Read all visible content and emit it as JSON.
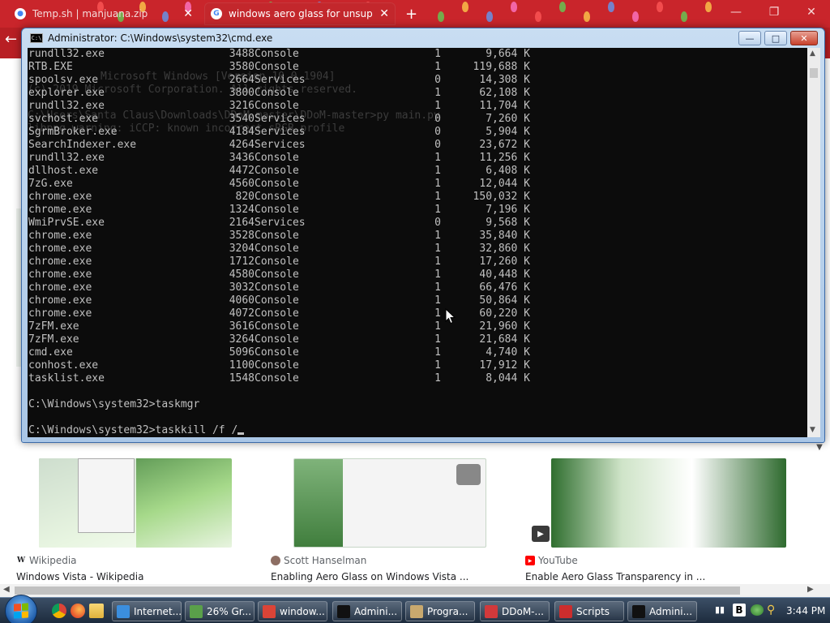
{
  "browser": {
    "tabs": [
      {
        "title": "Temp.sh | manjuana.zip",
        "active": false
      },
      {
        "title": "windows aero glass for unsuppo",
        "active": true
      }
    ],
    "new_tab": "+",
    "window_controls": {
      "minimize": "—",
      "restore": "❐",
      "close": "✕"
    },
    "back": "←",
    "results": [
      {
        "source": "Wikipedia",
        "title": "Windows Vista - Wikipedia",
        "icon": "wikipedia-icon"
      },
      {
        "source": "Scott Hanselman",
        "title": "Enabling Aero Glass on Windows Vista ...",
        "icon": "person-icon"
      },
      {
        "source": "YouTube",
        "title": "Enable Aero Glass Transparency in ...",
        "icon": "youtube-icon"
      }
    ],
    "accent": "#c9252b"
  },
  "cmd": {
    "title": "Administrator: C:\\Windows\\system32\\cmd.exe",
    "icon_label": "C:\\",
    "controls": {
      "minimize": "—",
      "maximize": "□",
      "close": "✕"
    },
    "background_ghost_lines": [
      "Microsoft Windows [Version 10.0.1904]",
      "(c) 2019 Microsoft Corporation. All rights reserved.",
      "C:\\Users\\Santa Claus\\Downloads\\DDoM-master\\DDoM-master>py main.py",
      "libpng warning: iCCP: known incorrect sRGB profile"
    ],
    "processes": [
      {
        "name": "rundll32.exe",
        "pid": "3488",
        "session": "Console",
        "num": "1",
        "mem": "9,664 K"
      },
      {
        "name": "RTB.EXE",
        "pid": "3580",
        "session": "Console",
        "num": "1",
        "mem": "119,688 K"
      },
      {
        "name": "spoolsv.exe",
        "pid": "2664",
        "session": "Services",
        "num": "0",
        "mem": "14,308 K"
      },
      {
        "name": "explorer.exe",
        "pid": "3800",
        "session": "Console",
        "num": "1",
        "mem": "62,108 K"
      },
      {
        "name": "rundll32.exe",
        "pid": "3216",
        "session": "Console",
        "num": "1",
        "mem": "11,704 K"
      },
      {
        "name": "svchost.exe",
        "pid": "3540",
        "session": "Services",
        "num": "0",
        "mem": "7,260 K"
      },
      {
        "name": "SgrmBroker.exe",
        "pid": "4184",
        "session": "Services",
        "num": "0",
        "mem": "5,904 K"
      },
      {
        "name": "SearchIndexer.exe",
        "pid": "4264",
        "session": "Services",
        "num": "0",
        "mem": "23,672 K"
      },
      {
        "name": "rundll32.exe",
        "pid": "3436",
        "session": "Console",
        "num": "1",
        "mem": "11,256 K"
      },
      {
        "name": "dllhost.exe",
        "pid": "4472",
        "session": "Console",
        "num": "1",
        "mem": "6,408 K"
      },
      {
        "name": "7zG.exe",
        "pid": "4560",
        "session": "Console",
        "num": "1",
        "mem": "12,044 K"
      },
      {
        "name": "chrome.exe",
        "pid": "820",
        "session": "Console",
        "num": "1",
        "mem": "150,032 K"
      },
      {
        "name": "chrome.exe",
        "pid": "1324",
        "session": "Console",
        "num": "1",
        "mem": "7,196 K"
      },
      {
        "name": "WmiPrvSE.exe",
        "pid": "2164",
        "session": "Services",
        "num": "0",
        "mem": "9,568 K"
      },
      {
        "name": "chrome.exe",
        "pid": "3528",
        "session": "Console",
        "num": "1",
        "mem": "35,840 K"
      },
      {
        "name": "chrome.exe",
        "pid": "3204",
        "session": "Console",
        "num": "1",
        "mem": "32,860 K"
      },
      {
        "name": "chrome.exe",
        "pid": "1712",
        "session": "Console",
        "num": "1",
        "mem": "17,260 K"
      },
      {
        "name": "chrome.exe",
        "pid": "4580",
        "session": "Console",
        "num": "1",
        "mem": "40,448 K"
      },
      {
        "name": "chrome.exe",
        "pid": "3032",
        "session": "Console",
        "num": "1",
        "mem": "66,476 K"
      },
      {
        "name": "chrome.exe",
        "pid": "4060",
        "session": "Console",
        "num": "1",
        "mem": "50,864 K"
      },
      {
        "name": "chrome.exe",
        "pid": "4072",
        "session": "Console",
        "num": "1",
        "mem": "60,220 K"
      },
      {
        "name": "7zFM.exe",
        "pid": "3616",
        "session": "Console",
        "num": "1",
        "mem": "21,960 K"
      },
      {
        "name": "7zFM.exe",
        "pid": "3264",
        "session": "Console",
        "num": "1",
        "mem": "21,684 K"
      },
      {
        "name": "cmd.exe",
        "pid": "5096",
        "session": "Console",
        "num": "1",
        "mem": "4,740 K"
      },
      {
        "name": "conhost.exe",
        "pid": "1100",
        "session": "Console",
        "num": "1",
        "mem": "17,912 K"
      },
      {
        "name": "tasklist.exe",
        "pid": "1548",
        "session": "Console",
        "num": "1",
        "mem": "8,044 K"
      }
    ],
    "prompt_lines": [
      "C:\\Windows\\system32>taskmgr",
      "C:\\Windows\\system32>taskkill /f /"
    ]
  },
  "taskbar": {
    "tasks": [
      {
        "label": "Internet...",
        "icon": "ie-icon"
      },
      {
        "label": "26% Gr...",
        "icon": "globe-icon"
      },
      {
        "label": "window...",
        "icon": "chrome-icon"
      },
      {
        "label": "Admini...",
        "icon": "cmd-icon"
      },
      {
        "label": "Progra...",
        "icon": "program-icon"
      },
      {
        "label": "DDoM-...",
        "icon": "ddom-icon"
      },
      {
        "label": "Scripts",
        "icon": "scripts-icon"
      },
      {
        "label": "Admini...",
        "icon": "cmd-icon"
      }
    ],
    "clock": "3:44 PM"
  }
}
